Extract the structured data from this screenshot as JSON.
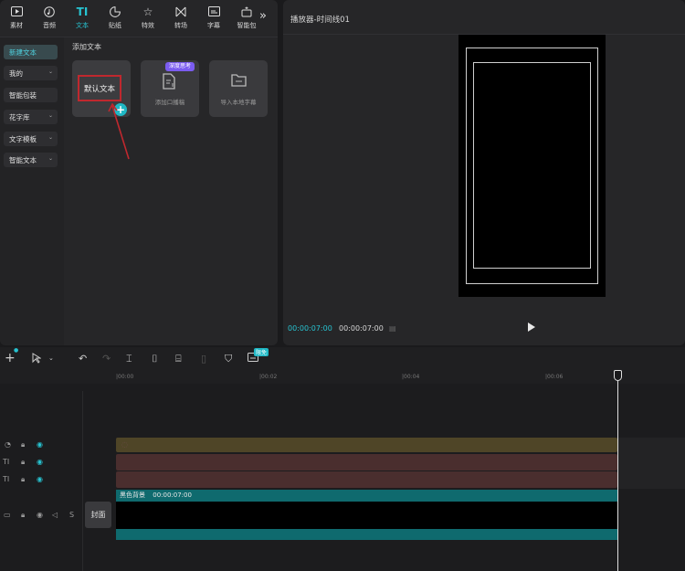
{
  "tabs": [
    {
      "label": "素材",
      "icon": "media-icon"
    },
    {
      "label": "音频",
      "icon": "audio-icon"
    },
    {
      "label": "文本",
      "icon": "text-icon",
      "active": true
    },
    {
      "label": "贴纸",
      "icon": "sticker-icon"
    },
    {
      "label": "特效",
      "icon": "effects-icon"
    },
    {
      "label": "转场",
      "icon": "transition-icon"
    },
    {
      "label": "字幕",
      "icon": "subtitle-icon"
    },
    {
      "label": "智能包",
      "icon": "smart-package-icon"
    }
  ],
  "more_symbol": "»",
  "side_nav": [
    {
      "label": "新建文本",
      "active": true,
      "chevron": false
    },
    {
      "label": "我的",
      "chevron": true
    },
    {
      "label": "智能包装",
      "chevron": false
    },
    {
      "label": "花字库",
      "chevron": true
    },
    {
      "label": "文字模板",
      "chevron": true
    },
    {
      "label": "智能文本",
      "chevron": true
    }
  ],
  "section_title": "添加文本",
  "cards": {
    "default_text": "默认文本",
    "add_symbol": "+",
    "voiceover_label": "添加口播稿",
    "voiceover_badge": "深度思考",
    "import_label": "导入本地字幕"
  },
  "player": {
    "title": "播放器-时间线01",
    "time_current": "00:00:07:00",
    "time_total": "00:00:07:00"
  },
  "toolbar": {
    "add_symbol": "+",
    "badge": "限免"
  },
  "ruler": [
    "00:00",
    "00:02",
    "00:04",
    "00:06"
  ],
  "tracks": {
    "main_clip_name": "黑色背景",
    "main_clip_time": "00:00:07:00",
    "cover_label": "封面",
    "mute_label": "S"
  },
  "colors": {
    "accent": "#27c3d1",
    "highlight_red": "#c0282e",
    "badge_purple": "#7b5cf0"
  }
}
